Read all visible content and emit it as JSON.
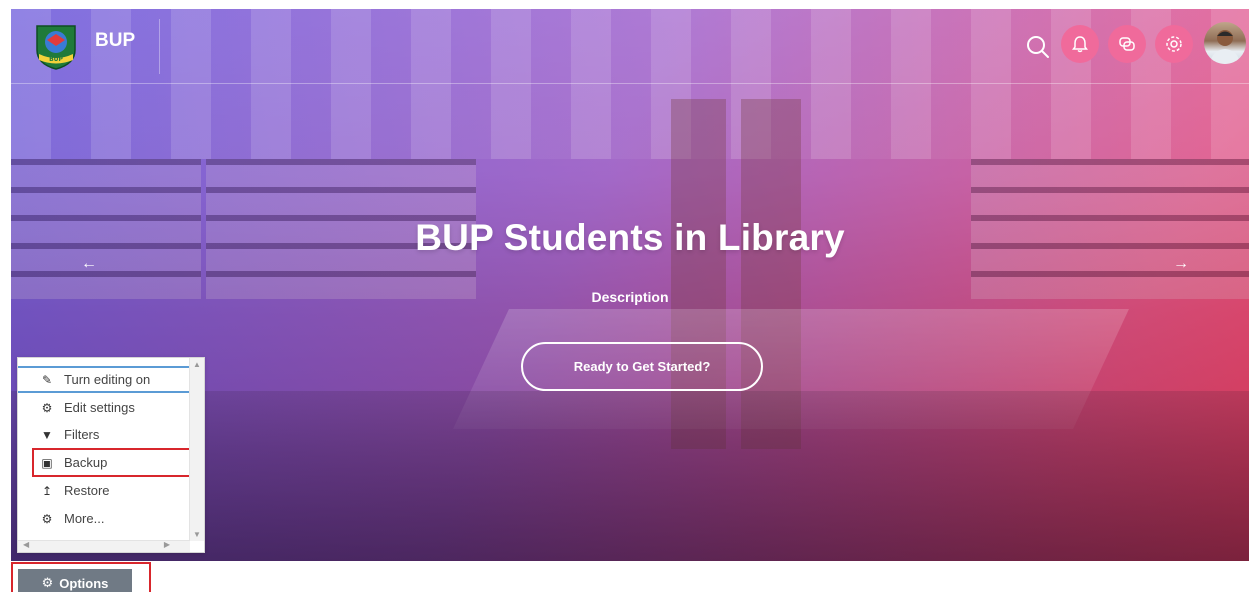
{
  "header": {
    "brand": "BUP",
    "logo_text": "BUP",
    "icons": [
      "search-icon",
      "bell-icon",
      "chat-icon",
      "gear-icon"
    ]
  },
  "slide": {
    "title": "BUP Students in Library",
    "description": "Description",
    "cta_label": "Ready to Get Started?",
    "prev_arrow": "←",
    "next_arrow": "→"
  },
  "menu": {
    "items": [
      {
        "label": "Turn editing on",
        "icon": "✎"
      },
      {
        "label": "Edit settings",
        "icon": "⚙"
      },
      {
        "label": "Filters",
        "icon": "▼"
      },
      {
        "label": "Backup",
        "icon": "▣"
      },
      {
        "label": "Restore",
        "icon": "↥"
      },
      {
        "label": "More...",
        "icon": "⚙"
      }
    ]
  },
  "options": {
    "label": "Options",
    "icon": "⚙"
  },
  "colors": {
    "accent_pink": "#f06a9b",
    "highlight_red": "#d8262c",
    "options_bg": "#707a85"
  }
}
